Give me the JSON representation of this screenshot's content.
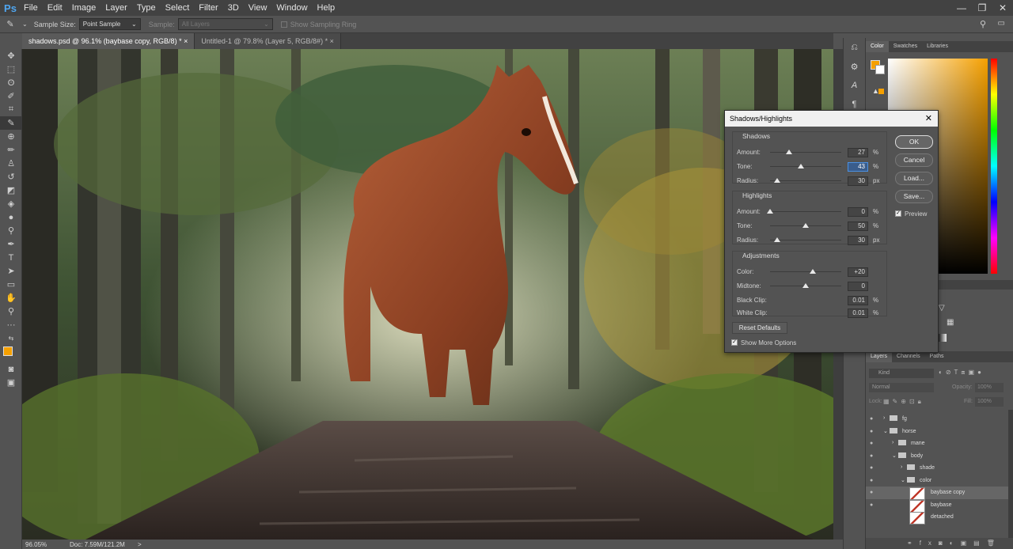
{
  "app": {
    "logo": "Ps"
  },
  "menu": [
    "File",
    "Edit",
    "Image",
    "Layer",
    "Type",
    "Select",
    "Filter",
    "3D",
    "View",
    "Window",
    "Help"
  ],
  "window_controls": [
    "—",
    "❐",
    "✕"
  ],
  "options_bar": {
    "sample_size_label": "Sample Size:",
    "sample_size_value": "Point Sample",
    "sample_label": "Sample:",
    "sample_value": "All Layers",
    "show_ring_label": "Show Sampling Ring"
  },
  "doc_tabs": [
    {
      "label": "shadows.psd @ 96.1% (baybase copy, RGB/8) *",
      "close": "×"
    },
    {
      "label": "Untitled-1 @ 79.8% (Layer 5, RGB/8#) *",
      "close": "×"
    }
  ],
  "status": {
    "zoom": "96.05%",
    "doc": "Doc: 7.59M/121.2M",
    "arrow": ">"
  },
  "right_panel": {
    "color_tabs": [
      "Color",
      "Swatches",
      "Libraries"
    ],
    "layers_tabs": [
      "Layers",
      "Channels",
      "Paths"
    ],
    "kind_label": "Kind",
    "blend_mode": "Normal",
    "opacity_label": "Opacity:",
    "opacity_value": "100%",
    "lock_label": "Lock:",
    "fill_label": "Fill:",
    "fill_value": "100%",
    "fg_color": "#f5a000",
    "layers": [
      {
        "name": "fg",
        "type": "group",
        "indent": 0,
        "visible": true,
        "expanded": false
      },
      {
        "name": "horse",
        "type": "group",
        "indent": 0,
        "visible": true,
        "expanded": true
      },
      {
        "name": "mane",
        "type": "group",
        "indent": 1,
        "visible": true,
        "expanded": false
      },
      {
        "name": "body",
        "type": "group",
        "indent": 1,
        "visible": true,
        "expanded": true
      },
      {
        "name": "shade",
        "type": "group",
        "indent": 2,
        "visible": true,
        "expanded": false
      },
      {
        "name": "color",
        "type": "group",
        "indent": 2,
        "visible": true,
        "expanded": true
      },
      {
        "name": "baybase copy",
        "type": "layer",
        "indent": 3,
        "visible": true,
        "selected": true
      },
      {
        "name": "baybase",
        "type": "layer",
        "indent": 3,
        "visible": true
      },
      {
        "name": "detached",
        "type": "layer",
        "indent": 3,
        "visible": false
      }
    ]
  },
  "dialog": {
    "title": "Shadows/Highlights",
    "close": "✕",
    "shadows": {
      "title": "Shadows",
      "rows": [
        {
          "label": "Amount:",
          "value": "27",
          "unit": "%",
          "level": 0.27
        },
        {
          "label": "Tone:",
          "value": "43",
          "unit": "%",
          "level": 0.43,
          "focused": true
        },
        {
          "label": "Radius:",
          "value": "30",
          "unit": "px",
          "level": 0.1
        }
      ]
    },
    "highlights": {
      "title": "Highlights",
      "rows": [
        {
          "label": "Amount:",
          "value": "0",
          "unit": "%",
          "level": 0.0
        },
        {
          "label": "Tone:",
          "value": "50",
          "unit": "%",
          "level": 0.5
        },
        {
          "label": "Radius:",
          "value": "30",
          "unit": "px",
          "level": 0.1
        }
      ]
    },
    "adjustments": {
      "title": "Adjustments",
      "rows": [
        {
          "label": "Color:",
          "value": "+20",
          "unit": "",
          "level": 0.6
        },
        {
          "label": "Midtone:",
          "value": "0",
          "unit": "",
          "level": 0.5
        },
        {
          "label": "Black Clip:",
          "value": "0.01",
          "unit": "%",
          "level": null
        },
        {
          "label": "White Clip:",
          "value": "0.01",
          "unit": "%",
          "level": null
        }
      ]
    },
    "buttons": {
      "ok": "OK",
      "cancel": "Cancel",
      "load": "Load...",
      "save": "Save..."
    },
    "preview_label": "Preview",
    "reset_label": "Reset Defaults",
    "more_options_label": "Show More Options"
  }
}
